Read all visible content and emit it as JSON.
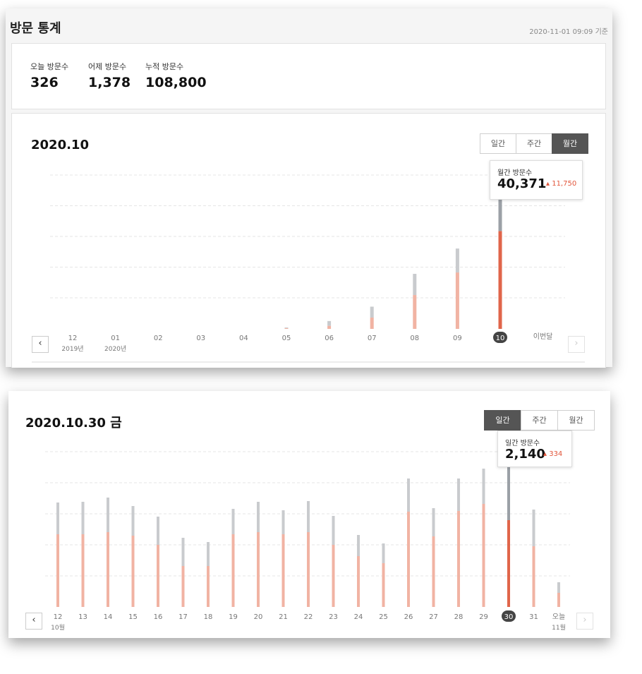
{
  "header": {
    "title": "방문 통계",
    "timestamp": "2020-11-01 09:09 기준"
  },
  "summary": [
    {
      "label": "오늘 방문수",
      "value": "326"
    },
    {
      "label": "어제 방문수",
      "value": "1,378"
    },
    {
      "label": "누적 방문수",
      "value": "108,800"
    }
  ],
  "colors": {
    "accent": "#e0654a",
    "accent_light": "#f1b3a3",
    "gray": "#9ba0a6",
    "gray_light": "#c9cbce"
  },
  "monthly": {
    "title": "2020.10",
    "segments": [
      "일간",
      "주간",
      "월간"
    ],
    "active_segment": "월간",
    "tooltip": {
      "label": "월간 방문수",
      "value": "40,371",
      "delta": "11,750"
    },
    "next_label": "이번달",
    "chart_data": {
      "type": "bar",
      "categories": [
        "12",
        "01",
        "02",
        "03",
        "04",
        "05",
        "06",
        "07",
        "08",
        "09",
        "10"
      ],
      "year_labels": {
        "12": "2019년",
        "01": "2020년"
      },
      "selected": "10",
      "series": [
        {
          "values": [
            0,
            0,
            0,
            0,
            0,
            200,
            900,
            3300,
            9900,
            16500,
            28621
          ]
        },
        {
          "values": [
            0,
            0,
            0,
            0,
            0,
            200,
            1400,
            3200,
            6200,
            7000,
            11750
          ]
        }
      ],
      "ylim": [
        0,
        45000
      ]
    }
  },
  "daily": {
    "title": "2020.10.30 금",
    "segments": [
      "일간",
      "주간",
      "월간"
    ],
    "active_segment": "일간",
    "tooltip": {
      "label": "일간 방문수",
      "value": "2,140",
      "delta": "334"
    },
    "next_label": "오늘",
    "chart_data": {
      "type": "bar",
      "categories": [
        "12",
        "13",
        "14",
        "15",
        "16",
        "17",
        "18",
        "19",
        "20",
        "21",
        "22",
        "23",
        "24",
        "25",
        "26",
        "27",
        "28",
        "29",
        "30",
        "31",
        "오늘"
      ],
      "month_labels": {
        "12": "10월",
        "오늘": "11월"
      },
      "selected": "30",
      "series": [
        {
          "values": [
            1030,
            1030,
            1060,
            1010,
            880,
            580,
            580,
            1030,
            1060,
            1030,
            1060,
            880,
            720,
            620,
            1350,
            1000,
            1360,
            1460,
            1230,
            860,
            200
          ]
        },
        {
          "values": [
            450,
            460,
            490,
            420,
            400,
            400,
            340,
            360,
            430,
            340,
            440,
            410,
            300,
            280,
            470,
            400,
            460,
            500,
            910,
            520,
            150
          ]
        }
      ],
      "ylim": [
        0,
        2200
      ]
    }
  }
}
